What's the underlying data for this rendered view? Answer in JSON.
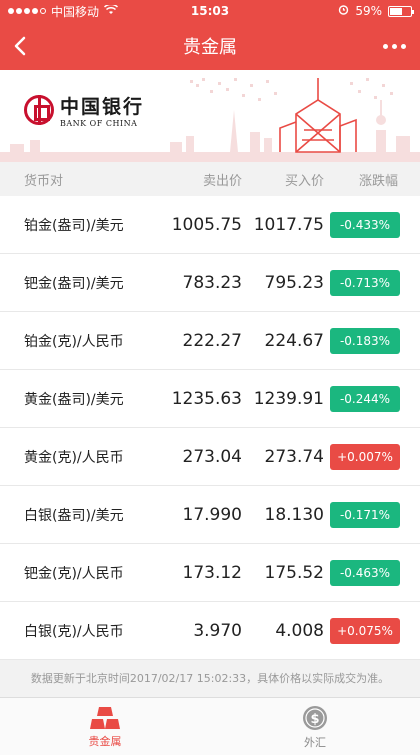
{
  "status": {
    "carrier": "中国移动",
    "time": "15:03",
    "battery": "59%",
    "battery_level": 0.59
  },
  "nav": {
    "title": "贵金属"
  },
  "banner": {
    "logo_cn": "中国银行",
    "logo_en": "BANK OF CHINA"
  },
  "table": {
    "headers": {
      "pair": "货币对",
      "sell": "卖出价",
      "buy": "买入价",
      "change": "涨跌幅"
    },
    "rows": [
      {
        "pair": "铂金(盎司)/美元",
        "sell": "1005.75",
        "buy": "1017.75",
        "change": "-0.433%",
        "dir": "down"
      },
      {
        "pair": "钯金(盎司)/美元",
        "sell": "783.23",
        "buy": "795.23",
        "change": "-0.713%",
        "dir": "down"
      },
      {
        "pair": "铂金(克)/人民币",
        "sell": "222.27",
        "buy": "224.67",
        "change": "-0.183%",
        "dir": "down"
      },
      {
        "pair": "黄金(盎司)/美元",
        "sell": "1235.63",
        "buy": "1239.91",
        "change": "-0.244%",
        "dir": "down"
      },
      {
        "pair": "黄金(克)/人民币",
        "sell": "273.04",
        "buy": "273.74",
        "change": "+0.007%",
        "dir": "up"
      },
      {
        "pair": "白银(盎司)/美元",
        "sell": "17.990",
        "buy": "18.130",
        "change": "-0.171%",
        "dir": "down"
      },
      {
        "pair": "钯金(克)/人民币",
        "sell": "173.12",
        "buy": "175.52",
        "change": "-0.463%",
        "dir": "down"
      },
      {
        "pair": "白银(克)/人民币",
        "sell": "3.970",
        "buy": "4.008",
        "change": "+0.075%",
        "dir": "up"
      }
    ]
  },
  "footnote": "数据更新于北京时间2017/02/17 15:02:33，具体价格以实际成交为准。",
  "tabs": [
    {
      "label": "贵金属",
      "icon": "gold-bars-icon",
      "active": true
    },
    {
      "label": "外汇",
      "icon": "currency-coin-icon",
      "active": false
    }
  ],
  "colors": {
    "brand": "#e94b45",
    "down": "#1bb77f",
    "up": "#e94b45"
  }
}
